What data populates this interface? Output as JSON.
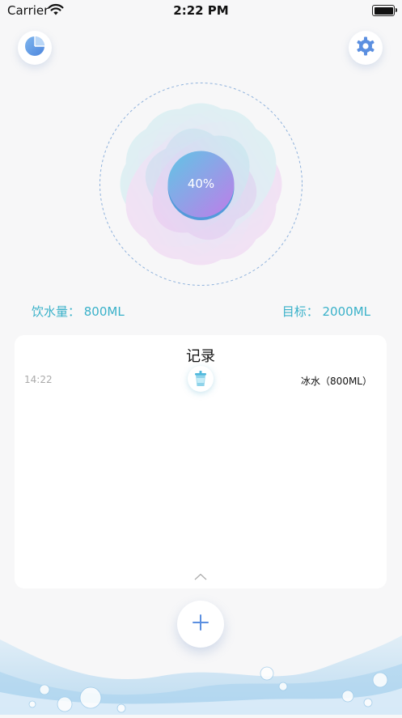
{
  "status_bar": {
    "carrier": "Carrier",
    "time": "2:22 PM"
  },
  "icons": {
    "stats": "pie-chart-icon",
    "settings": "gear-icon",
    "add": "plus-icon",
    "cup": "water-cup-icon",
    "chevron": "chevron-up-icon"
  },
  "progress": {
    "label": "40%",
    "fraction": 0.4
  },
  "intake": {
    "text": "饮水量： 800ML"
  },
  "goal": {
    "text": "目标： 2000ML"
  },
  "records": {
    "title": "记录",
    "items": [
      {
        "time": "14:22",
        "detail": "冰水（800ML）"
      }
    ]
  },
  "colors": {
    "accent": "#39b1c9",
    "primary": "#5b8fe0",
    "purple": "#b47ce6"
  }
}
